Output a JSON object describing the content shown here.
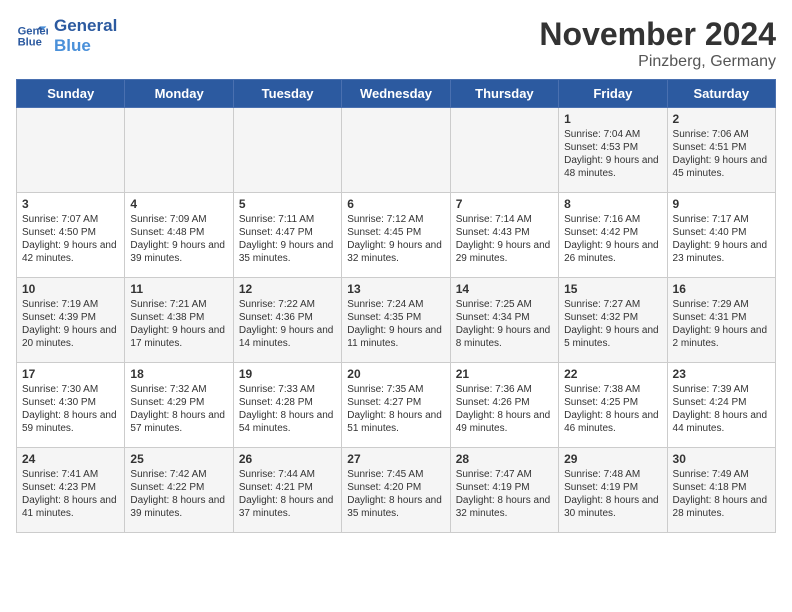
{
  "header": {
    "logo_line1": "General",
    "logo_line2": "Blue",
    "month_title": "November 2024",
    "location": "Pinzberg, Germany"
  },
  "days_of_week": [
    "Sunday",
    "Monday",
    "Tuesday",
    "Wednesday",
    "Thursday",
    "Friday",
    "Saturday"
  ],
  "weeks": [
    [
      {
        "day": "",
        "info": ""
      },
      {
        "day": "",
        "info": ""
      },
      {
        "day": "",
        "info": ""
      },
      {
        "day": "",
        "info": ""
      },
      {
        "day": "",
        "info": ""
      },
      {
        "day": "1",
        "info": "Sunrise: 7:04 AM\nSunset: 4:53 PM\nDaylight: 9 hours and 48 minutes."
      },
      {
        "day": "2",
        "info": "Sunrise: 7:06 AM\nSunset: 4:51 PM\nDaylight: 9 hours and 45 minutes."
      }
    ],
    [
      {
        "day": "3",
        "info": "Sunrise: 7:07 AM\nSunset: 4:50 PM\nDaylight: 9 hours and 42 minutes."
      },
      {
        "day": "4",
        "info": "Sunrise: 7:09 AM\nSunset: 4:48 PM\nDaylight: 9 hours and 39 minutes."
      },
      {
        "day": "5",
        "info": "Sunrise: 7:11 AM\nSunset: 4:47 PM\nDaylight: 9 hours and 35 minutes."
      },
      {
        "day": "6",
        "info": "Sunrise: 7:12 AM\nSunset: 4:45 PM\nDaylight: 9 hours and 32 minutes."
      },
      {
        "day": "7",
        "info": "Sunrise: 7:14 AM\nSunset: 4:43 PM\nDaylight: 9 hours and 29 minutes."
      },
      {
        "day": "8",
        "info": "Sunrise: 7:16 AM\nSunset: 4:42 PM\nDaylight: 9 hours and 26 minutes."
      },
      {
        "day": "9",
        "info": "Sunrise: 7:17 AM\nSunset: 4:40 PM\nDaylight: 9 hours and 23 minutes."
      }
    ],
    [
      {
        "day": "10",
        "info": "Sunrise: 7:19 AM\nSunset: 4:39 PM\nDaylight: 9 hours and 20 minutes."
      },
      {
        "day": "11",
        "info": "Sunrise: 7:21 AM\nSunset: 4:38 PM\nDaylight: 9 hours and 17 minutes."
      },
      {
        "day": "12",
        "info": "Sunrise: 7:22 AM\nSunset: 4:36 PM\nDaylight: 9 hours and 14 minutes."
      },
      {
        "day": "13",
        "info": "Sunrise: 7:24 AM\nSunset: 4:35 PM\nDaylight: 9 hours and 11 minutes."
      },
      {
        "day": "14",
        "info": "Sunrise: 7:25 AM\nSunset: 4:34 PM\nDaylight: 9 hours and 8 minutes."
      },
      {
        "day": "15",
        "info": "Sunrise: 7:27 AM\nSunset: 4:32 PM\nDaylight: 9 hours and 5 minutes."
      },
      {
        "day": "16",
        "info": "Sunrise: 7:29 AM\nSunset: 4:31 PM\nDaylight: 9 hours and 2 minutes."
      }
    ],
    [
      {
        "day": "17",
        "info": "Sunrise: 7:30 AM\nSunset: 4:30 PM\nDaylight: 8 hours and 59 minutes."
      },
      {
        "day": "18",
        "info": "Sunrise: 7:32 AM\nSunset: 4:29 PM\nDaylight: 8 hours and 57 minutes."
      },
      {
        "day": "19",
        "info": "Sunrise: 7:33 AM\nSunset: 4:28 PM\nDaylight: 8 hours and 54 minutes."
      },
      {
        "day": "20",
        "info": "Sunrise: 7:35 AM\nSunset: 4:27 PM\nDaylight: 8 hours and 51 minutes."
      },
      {
        "day": "21",
        "info": "Sunrise: 7:36 AM\nSunset: 4:26 PM\nDaylight: 8 hours and 49 minutes."
      },
      {
        "day": "22",
        "info": "Sunrise: 7:38 AM\nSunset: 4:25 PM\nDaylight: 8 hours and 46 minutes."
      },
      {
        "day": "23",
        "info": "Sunrise: 7:39 AM\nSunset: 4:24 PM\nDaylight: 8 hours and 44 minutes."
      }
    ],
    [
      {
        "day": "24",
        "info": "Sunrise: 7:41 AM\nSunset: 4:23 PM\nDaylight: 8 hours and 41 minutes."
      },
      {
        "day": "25",
        "info": "Sunrise: 7:42 AM\nSunset: 4:22 PM\nDaylight: 8 hours and 39 minutes."
      },
      {
        "day": "26",
        "info": "Sunrise: 7:44 AM\nSunset: 4:21 PM\nDaylight: 8 hours and 37 minutes."
      },
      {
        "day": "27",
        "info": "Sunrise: 7:45 AM\nSunset: 4:20 PM\nDaylight: 8 hours and 35 minutes."
      },
      {
        "day": "28",
        "info": "Sunrise: 7:47 AM\nSunset: 4:19 PM\nDaylight: 8 hours and 32 minutes."
      },
      {
        "day": "29",
        "info": "Sunrise: 7:48 AM\nSunset: 4:19 PM\nDaylight: 8 hours and 30 minutes."
      },
      {
        "day": "30",
        "info": "Sunrise: 7:49 AM\nSunset: 4:18 PM\nDaylight: 8 hours and 28 minutes."
      }
    ]
  ]
}
